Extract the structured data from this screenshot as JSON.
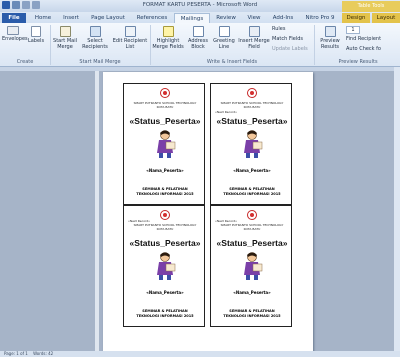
{
  "window": {
    "title": "FORMAT KARTU PESERTA - Microsoft Word",
    "context_tab_group": "Table Tools"
  },
  "tabs": [
    "File",
    "Home",
    "Insert",
    "Page Layout",
    "References",
    "Mailings",
    "Review",
    "View",
    "Add-Ins",
    "Nitro Pro 9",
    "Design",
    "Layout"
  ],
  "ribbon": {
    "create": {
      "envelopes": "Envelopes",
      "labels": "Labels",
      "group": "Create"
    },
    "start": {
      "start_mail_merge": "Start Mail Merge",
      "select_recipients": "Select Recipients",
      "edit_list": "Edit Recipient List",
      "group": "Start Mail Merge"
    },
    "write": {
      "highlight": "Highlight Merge Fields",
      "address_block": "Address Block",
      "greeting_line": "Greeting Line",
      "insert_merge_field": "Insert Merge Field",
      "rules": "Rules",
      "match_fields": "Match Fields",
      "update_labels": "Update Labels",
      "group": "Write & Insert Fields"
    },
    "preview": {
      "preview_results": "Preview Results",
      "record": "1",
      "find_recipient": "Find Recipient",
      "auto_check": "Auto Check fo",
      "group": "Preview Results"
    }
  },
  "card": {
    "header_left": "«Next Record»",
    "school_line1": "SMART PUTRANTO SCHOOL TECHNOLOGY",
    "school_line2": "KOTA BATU",
    "status": "«Status_Peserta»",
    "nama": "«Nama_Peserta»",
    "seminar_line1": "SEMINAR & PELATIHAN",
    "seminar_line2": "TEKNOLOGI INFORMASI 2015"
  },
  "statusbar": {
    "page": "Page: 1 of 1",
    "words": "Words: 42"
  }
}
